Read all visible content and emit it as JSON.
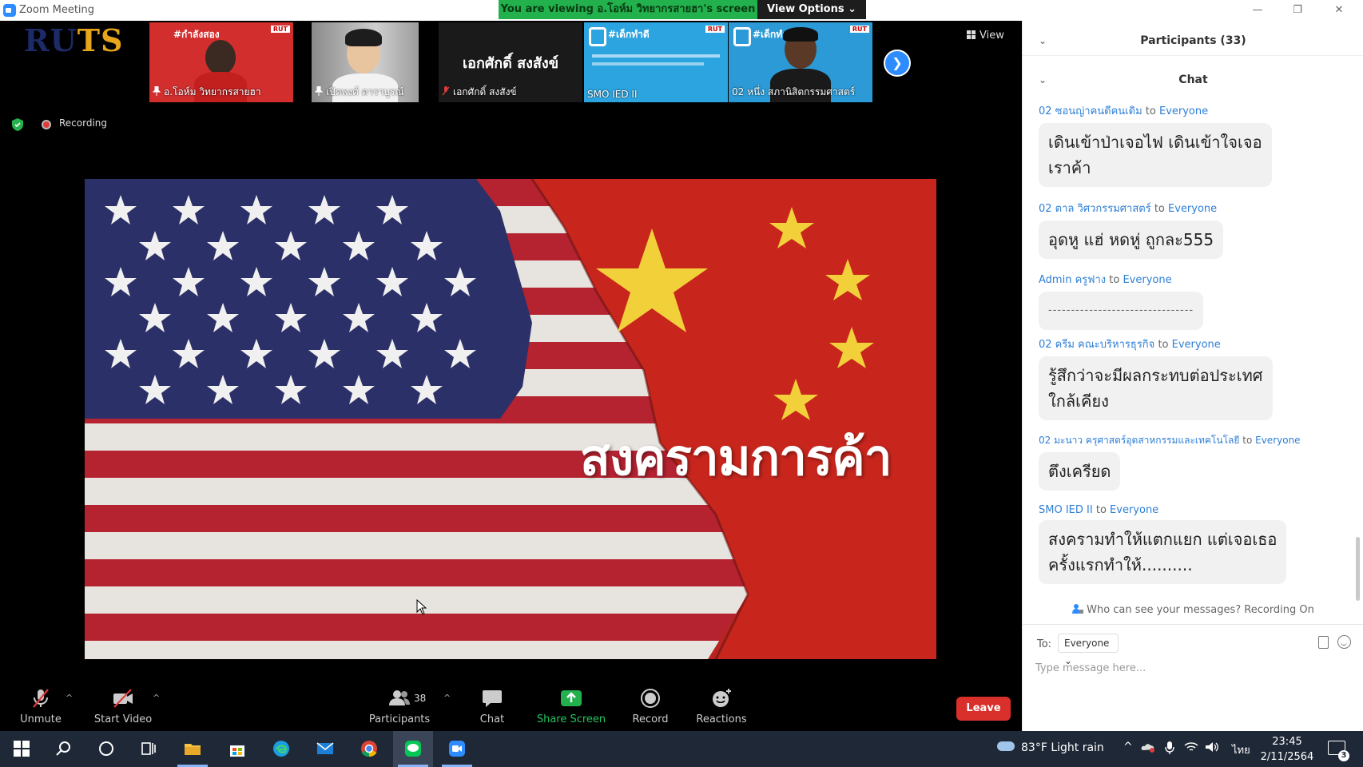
{
  "window": {
    "title": "Zoom Meeting",
    "minimize": "—",
    "restore": "❐",
    "close": "✕"
  },
  "share_banner": {
    "text": "You are viewing อ.โอห์ม วิทยากรสายฮา's screen",
    "view_options": "View Options ⌄"
  },
  "logo": {
    "part1": "RU",
    "part2": "TS",
    "subtext": ""
  },
  "thumbnails": [
    {
      "name": "อ.โอห์ม วิทยากรสายฮา",
      "bg": "#d22e2e",
      "poster": "#กำลังสอง",
      "mic": "pinned"
    },
    {
      "name": "เปิดพงศ์ ดาราบูรณ์",
      "bg": "#9c9c9c",
      "poster": "",
      "mic": "pinned"
    },
    {
      "name": "เอกศักดิ์ สงสังข์",
      "bg": "#1a1a1a",
      "poster": "เอกศักดิ์ สงสังข์",
      "mic": "muted"
    },
    {
      "name": "SMO IED II",
      "bg": "#2ba4e0",
      "poster": "#เด็กทำดี",
      "mic": "none"
    },
    {
      "name": "02 หนึ่ง สภานิสิตกรรมศาสตร์",
      "bg": "#2b9ad6",
      "poster": "#เด็กทำ",
      "mic": "none"
    }
  ],
  "view_button": "View",
  "recording_label": "Recording",
  "slide": {
    "title": "สงครามการค้า"
  },
  "toolbar": {
    "unmute": "Unmute",
    "start_video": "Start Video",
    "participants": "Participants",
    "participants_count": "38",
    "chat": "Chat",
    "share_screen": "Share Screen",
    "record": "Record",
    "reactions": "Reactions",
    "leave": "Leave"
  },
  "panel": {
    "participants_header": "Participants (33)",
    "chat_header": "Chat",
    "messages": [
      {
        "sender": "02 ซอนญ่าคนดีคนเดิม",
        "to": "to",
        "recipient": "Everyone",
        "text_lines": [
          "เดินเข้าป่าเจอไฟ เดินเข้าใจเจอ",
          "เราค้า"
        ]
      },
      {
        "sender": "02 ตาล วิศวกรรมศาสตร์",
        "to": "to",
        "recipient": "Everyone",
        "text_lines": [
          "อุดหู แฮ่ หดหู่ ถูกละ555"
        ]
      },
      {
        "sender": "Admin ครูฟาง",
        "to": "to",
        "recipient": "Everyone",
        "text_lines": [
          "--------------------------------"
        ]
      },
      {
        "sender": "02 ครีม คณะบริหารธุรกิจ",
        "to": "to",
        "recipient": "Everyone",
        "text_lines": [
          "รู้สึกว่าจะมีผลกระทบต่อประเทศ",
          "ใกล้เคียง"
        ]
      },
      {
        "sender": "02 มะนาว ครุศาสตร์อุตสาหกรรมและเทคโนโลยี",
        "to": "to",
        "recipient": "Everyone",
        "text_lines": [
          "ตึงเครียด"
        ]
      },
      {
        "sender": "SMO IED II",
        "to": "to",
        "recipient": "Everyone",
        "text_lines": [
          "สงครามทำให้แตกแยก แต่เจอเธอ",
          "ครั้งแรกทำให้.........."
        ]
      }
    ],
    "privacy_note": "Who can see your messages? Recording On",
    "to_label": "To:",
    "to_value": "Everyone ⌄",
    "input_placeholder": "Type message here..."
  },
  "taskbar": {
    "weather": "83°F  Light rain",
    "language": "ไทย",
    "time": "23:45",
    "date": "2/11/2564",
    "notifications": "3"
  },
  "colors": {
    "accent": "#2d8cff",
    "share_green": "#22b14c",
    "leave_red": "#d9302c",
    "chat_sender": "#2e7fd6"
  }
}
